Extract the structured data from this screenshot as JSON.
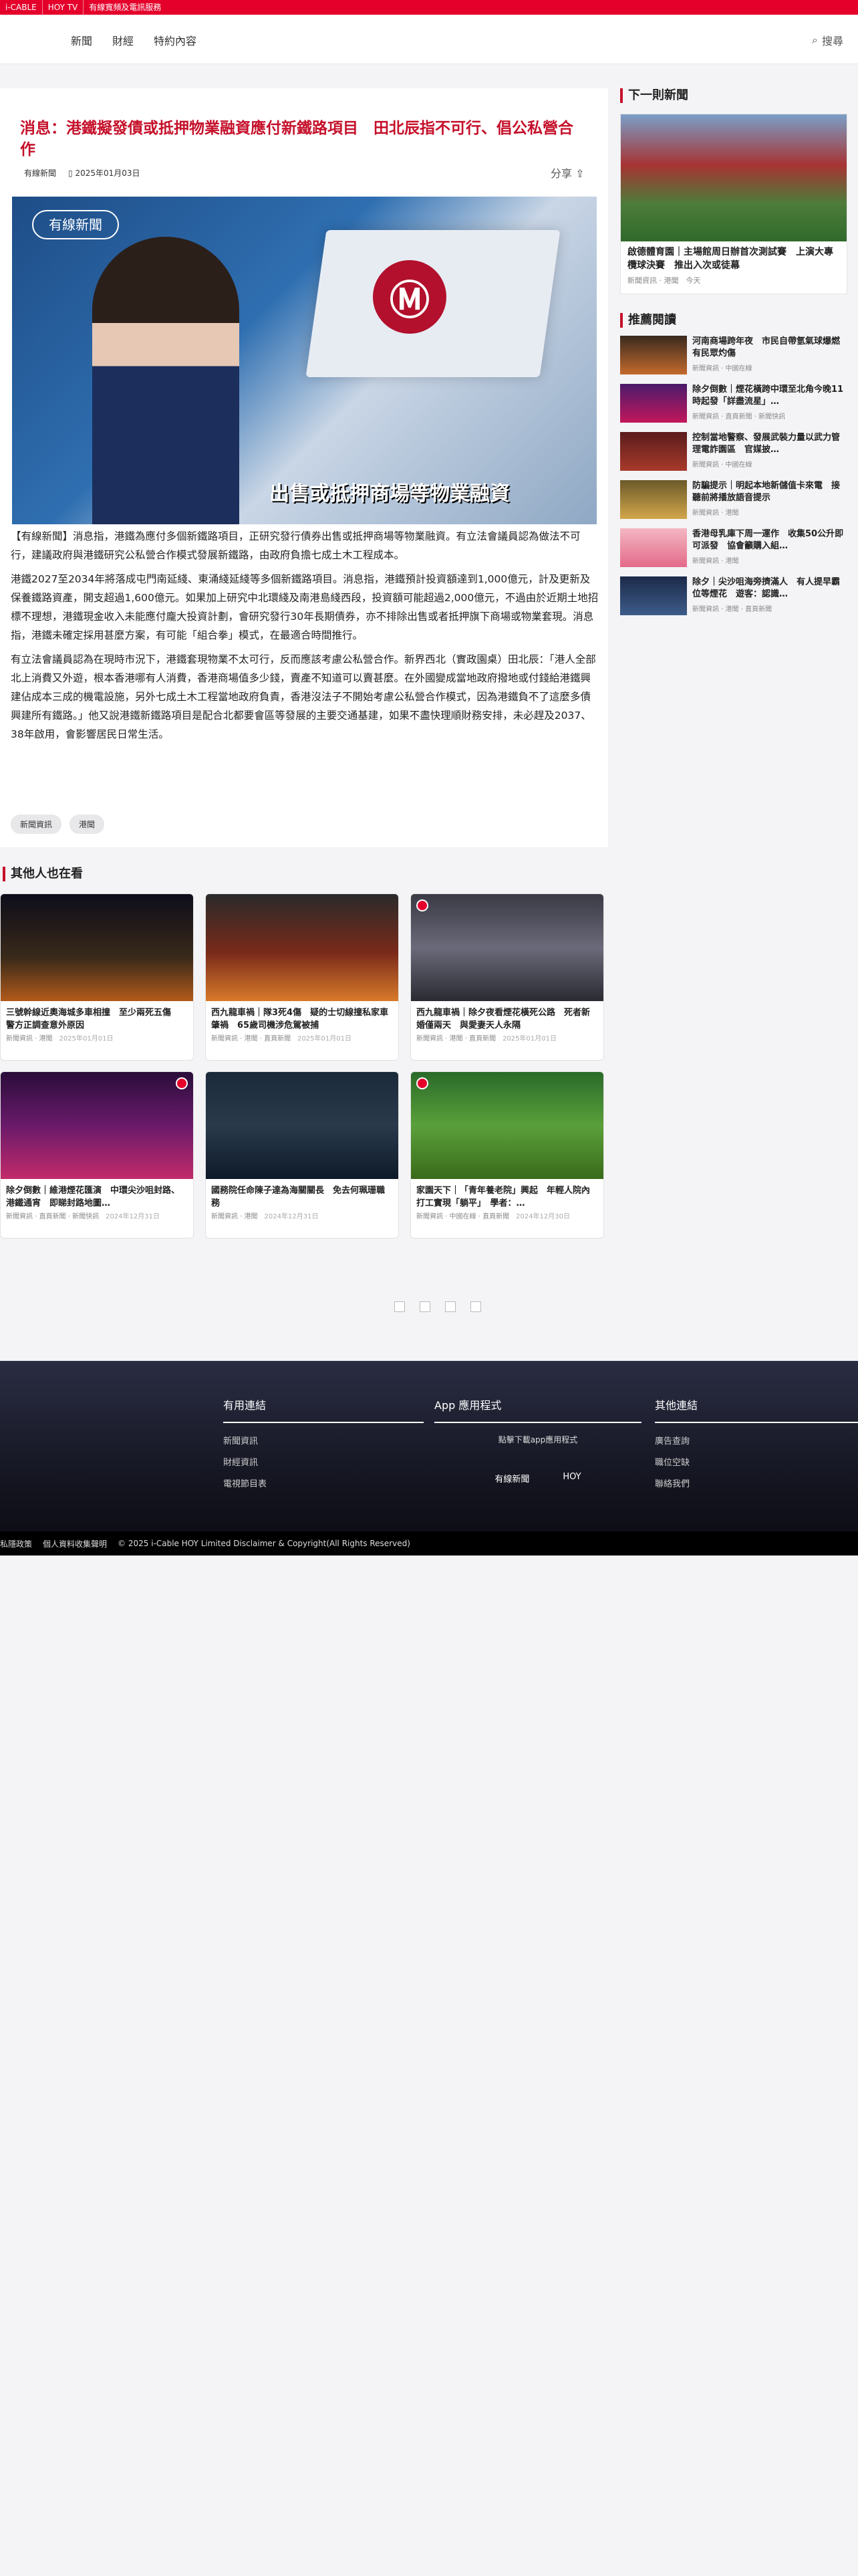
{
  "topbar": {
    "items": [
      "i-CABLE",
      "HOY TV",
      "有線寬頻及電訊服務"
    ]
  },
  "header": {
    "nav": [
      "新聞",
      "財經",
      "特約內容"
    ],
    "search_label": "搜尋"
  },
  "article": {
    "title": "消息：港鐵擬發債或抵押物業融資應付新鐵路項目　田北辰指不可行、倡公私營合作",
    "source": "有線新聞",
    "date": "2025年01月03日",
    "share_label": "分享",
    "hero_logo": "有線新聞",
    "hero_caption": "出售或抵押商場等物業融資",
    "paragraphs": [
      "【有線新聞】消息指，港鐵為應付多個新鐵路項目，正研究發行債券出售或抵押商場等物業融資。有立法會議員認為做法不可行，建議政府與港鐵研究公私營合作模式發展新鐵路，由政府負擔七成土木工程成本。",
      "港鐵2027至2034年將落成屯門南延綫、東涌綫延綫等多個新鐵路項目。消息指，港鐵預計投資額達到1,000億元，計及更新及保養鐵路資產，開支超過1,600億元。如果加上研究中北環綫及南港島綫西段，投資額可能超過2,000億元，不過由於近期土地招標不理想，港鐵現金收入未能應付龐大投資計劃，會研究發行30年長期債券，亦不排除出售或者抵押旗下商場或物業套現。消息指，港鐵未確定採用甚麼方案，有可能「組合拳」模式，在最適合時間推行。",
      "有立法會議員認為在現時市況下，港鐵套現物業不太可行，反而應該考慮公私營合作。新界西北（實政園桌）田北辰：「港人全部北上消費又外遊，根本香港哪有人消費，香港商場值多少錢，賣產不知道可以賣甚麼。在外國變成當地政府撥地或付錢給港鐵興建佔成本三成的機電設施，另外七成土木工程當地政府負責，香港沒法子不開始考慮公私營合作模式，因為港鐵負不了這麼多債興建所有鐵路。」他又說港鐵新鐵路項目是配合北都要會區等發展的主要交通基建，如果不盡快理順財務安排，未必趕及2037、38年啟用，會影響居民日常生活。"
    ],
    "tags": [
      "新聞資訊",
      "港聞"
    ]
  },
  "sidebar": {
    "next_heading": "下一則新聞",
    "next": {
      "title": "啟德體育園｜主場館周日辦首次測試賽　上演大專欖球決賽　推出入次或徒幕",
      "meta": "新聞資訊 · 港聞",
      "date": "今天"
    },
    "rec_heading": "推薦閱讀",
    "recommended": [
      {
        "title": "河南商場跨年夜　市民自帶氫氣球爆燃　有民眾灼傷",
        "meta": "新聞資訊 · 中國在線"
      },
      {
        "title": "除夕倒數｜煙花橫跨中環至北角今晚11時起發「詳盡流星」…",
        "meta": "新聞資訊 · 直頁新聞 · 新聞快訊"
      },
      {
        "title": "控制當地警察、發展武裝力量以武力管理電詐園區　官媒披…",
        "meta": "新聞資訊 · 中國在線"
      },
      {
        "title": "防騙提示｜明起本地新儲值卡來電　接聽前將播放語音提示",
        "meta": "新聞資訊 · 港聞"
      },
      {
        "title": "香港母乳庫下周一運作　收集50公升即可派發　協會籲購入組…",
        "meta": "新聞資訊 · 港聞"
      },
      {
        "title": "除夕｜尖沙咀海旁擠滿人　有人提早霸位等煙花　遊客：認識…",
        "meta": "新聞資訊 · 港聞 · 直頁新聞"
      }
    ]
  },
  "others": {
    "heading": "其他人也在看",
    "cards": [
      {
        "title": "三號幹線近奧海城多車相撞　至少兩死五傷　警方正調查意外原因",
        "meta": "新聞資訊 · 港聞",
        "date": "2025年01月01日",
        "img": "night-crash"
      },
      {
        "title": "西九龍車禍｜隊3死4傷　疑的士切線撞私家車肇禍　65歲司機涉危駕被捕",
        "meta": "新聞資訊 · 港聞 · 直頁新聞",
        "date": "2025年01月01日",
        "img": "rescue"
      },
      {
        "title": "西九龍車禍｜除夕夜看煙花橫死公路　死者新婚僅兩天　與愛妻天人永隔",
        "meta": "新聞資訊 · 港聞 · 直頁新聞",
        "date": "2025年01月01日",
        "img": "wedding"
      },
      {
        "title": "除夕倒數｜維港煙花匯演　中環尖沙咀封路、港鐵通宵　即睇封路地圖…",
        "meta": "新聞資訊 · 直頁新聞 · 新聞快訊",
        "date": "2024年12月31日",
        "img": "fireworks"
      },
      {
        "title": "國務院任命陳子達為海關關長　免去何珮珊職務",
        "meta": "新聞資訊 · 港聞",
        "date": "2024年12月31日",
        "img": "customs"
      },
      {
        "title": "家園天下｜「青年養老院」興起　年輕人院內打工實現「躺平」　學者：…",
        "meta": "新聞資訊 · 中國在線 · 直頁新聞",
        "date": "2024年12月30日",
        "img": "youth"
      }
    ]
  },
  "footer": {
    "col1_heading": "有用連結",
    "col1_links": [
      "新聞資訊",
      "財經資訊",
      "電視節目表"
    ],
    "col2_heading": "App 應用程式",
    "col2_text": "點擊下載app應用程式",
    "col2_apps": [
      "有線新聞",
      "HOY"
    ],
    "col3_heading": "其他連結",
    "col3_links": [
      "廣告查詢",
      "職位空缺",
      "聯絡我們"
    ],
    "bottom": [
      "私隱政策",
      "個人資料收集聲明",
      "© 2025 i-Cable HOY Limited Disclaimer & Copyright(All Rights Reserved)"
    ]
  },
  "colors": {
    "brand_red": "#e4002b",
    "title_red": "#c5102a"
  }
}
